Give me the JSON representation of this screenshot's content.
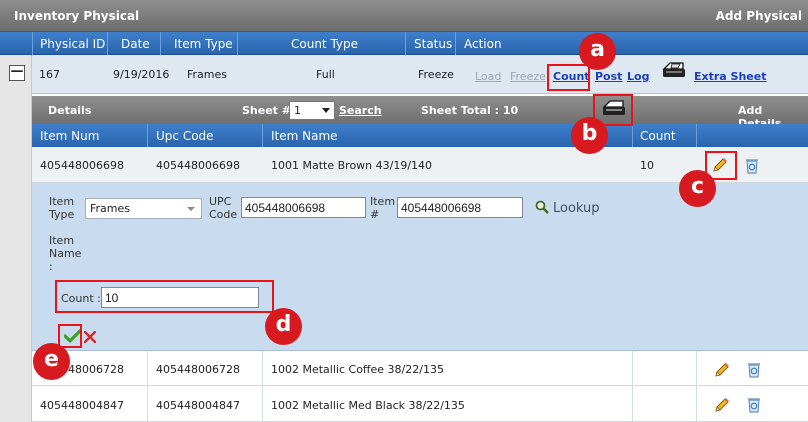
{
  "header": {
    "title": "Inventory Physical",
    "add_label": "Add Physical"
  },
  "columns": {
    "physical_id": "Physical ID",
    "date": "Date",
    "item_type": "Item Type",
    "count_type": "Count Type",
    "status": "Status",
    "action": "Action"
  },
  "record": {
    "collapse_symbol": "—",
    "physical_id": "167",
    "date": "9/19/2016",
    "item_type": "Frames",
    "count_type": "Full",
    "status": "Freeze",
    "actions": {
      "load": "Load",
      "freeze": "Freeze",
      "count": "Count",
      "post": "Post",
      "log": "Log",
      "extra_sheet": "Extra Sheet"
    }
  },
  "details_bar": {
    "title": "Details",
    "sheet_label": "Sheet #",
    "sheet_value": "1",
    "search": "Search",
    "sheet_total": "Sheet Total : 10",
    "add_details": "Add Details"
  },
  "detail_columns": {
    "item_num": "Item Num",
    "upc_code": "Upc Code",
    "item_name": "Item Name",
    "count": "Count"
  },
  "rows": [
    {
      "item_num": "405448006698",
      "upc_code": "405448006698",
      "item_name": "1001 Matte Brown 43/19/140",
      "count": "10"
    },
    {
      "item_num": "405448006728",
      "upc_code": "405448006728",
      "item_name": "1002 Metallic Coffee 38/22/135",
      "count": ""
    },
    {
      "item_num": "405448004847",
      "upc_code": "405448004847",
      "item_name": "1002 Metallic Med Black 38/22/135",
      "count": ""
    }
  ],
  "edit": {
    "item_type_label_1": "Item",
    "item_type_label_2": "Type",
    "item_type_value": "Frames",
    "upc_label_1": "UPC",
    "upc_label_2": "Code",
    "upc_value": "405448006698",
    "item_num_label_1": "Item",
    "item_num_label_2": "#",
    "item_num_value": "405448006698",
    "lookup": "Lookup",
    "item_name_label_1": "Item",
    "item_name_label_2": "Name",
    "item_name_label_3": ":",
    "count_label": "Count :",
    "count_value": "10"
  },
  "callouts": {
    "a": "a",
    "b": "b",
    "c": "c",
    "d": "d",
    "e": "e"
  },
  "icons": [
    "collapse-icon",
    "printer-icon",
    "pencil-icon",
    "recycle-bin-icon",
    "magnifier-icon",
    "check-icon",
    "cancel-x-icon",
    "dropdown-arrow-icon"
  ],
  "colors": {
    "header_blue": "#2f6db8",
    "panel_blue": "#c9dcef",
    "callout_red": "#d71920",
    "link_blue": "#1a3fb8"
  }
}
